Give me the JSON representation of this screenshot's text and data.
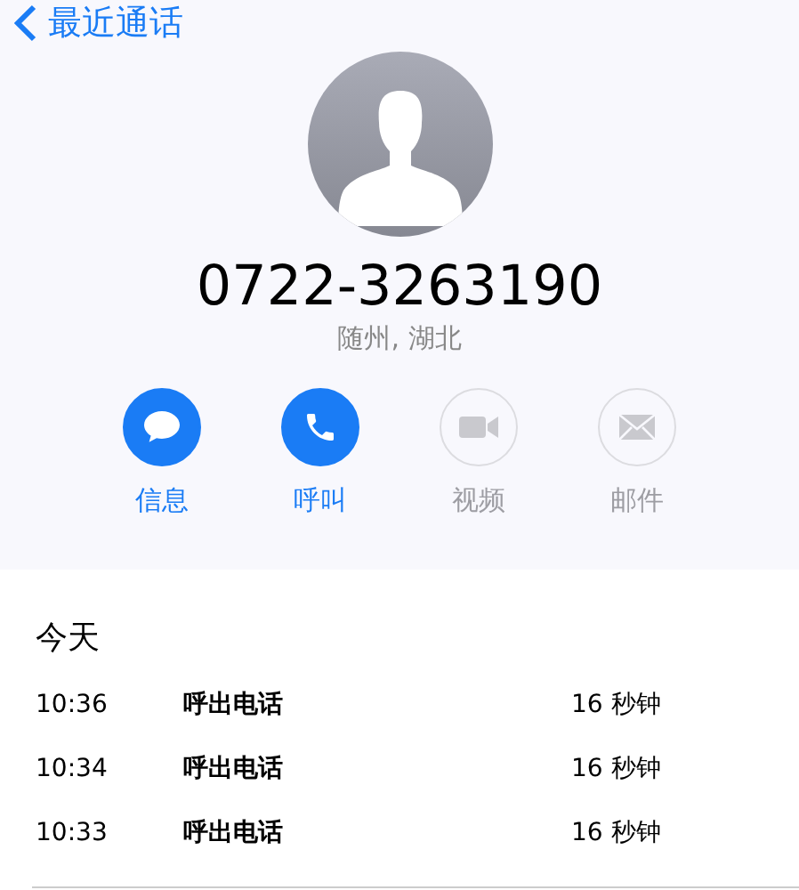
{
  "nav": {
    "back_label": "最近通话"
  },
  "contact": {
    "number": "0722-3263190",
    "location": "随州, 湖北"
  },
  "actions": [
    {
      "kind": "message",
      "label": "信息",
      "disabled": false
    },
    {
      "kind": "call",
      "label": "呼叫",
      "disabled": false
    },
    {
      "kind": "video",
      "label": "视频",
      "disabled": true
    },
    {
      "kind": "mail",
      "label": "邮件",
      "disabled": true
    }
  ],
  "history": {
    "heading": "今天",
    "calls": [
      {
        "time": "10:36",
        "type": "呼出电话",
        "duration": "16 秒钟"
      },
      {
        "time": "10:34",
        "type": "呼出电话",
        "duration": "16 秒钟"
      },
      {
        "time": "10:33",
        "type": "呼出电话",
        "duration": "16 秒钟"
      }
    ]
  }
}
